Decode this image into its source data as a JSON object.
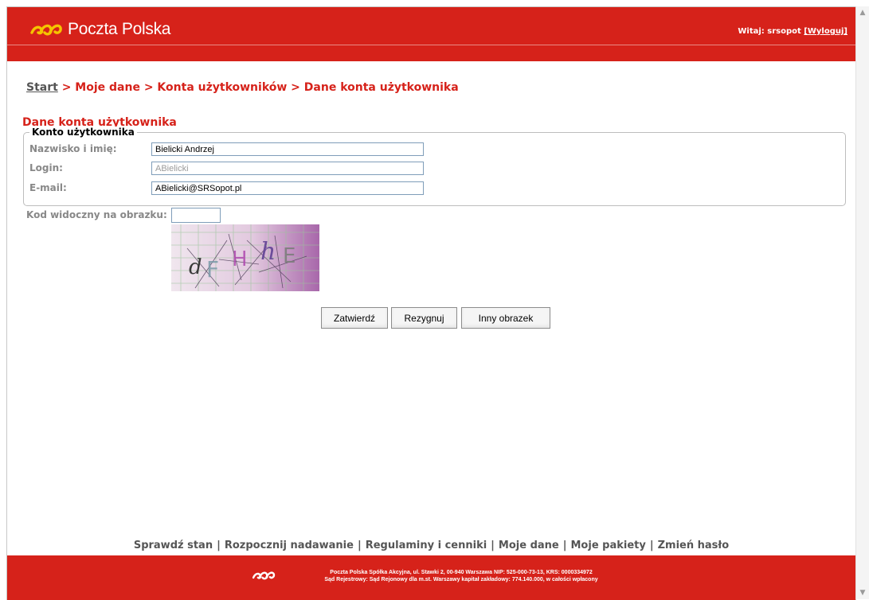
{
  "header": {
    "logo_text": "Poczta Polska",
    "welcome_prefix": "Witaj: srsopot",
    "logout_label": "[Wyloguj]"
  },
  "breadcrumb": {
    "start": "Start",
    "rest": " > Moje dane > Konta użytkowników > Dane konta użytkownika"
  },
  "page_title": "Dane konta użytkownika",
  "account": {
    "legend": "Konto użytkownika",
    "fields": [
      {
        "label": "Nazwisko i imię:",
        "value": "Bielicki Andrzej",
        "enabled": true
      },
      {
        "label": "Login:",
        "value": "ABielicki",
        "enabled": false
      },
      {
        "label": "E-mail:",
        "value": "ABielicki@SRSopot.pl",
        "enabled": true
      }
    ]
  },
  "captcha": {
    "label": "Kod widoczny na obrazku:",
    "value": "",
    "chars": [
      "d",
      "F",
      "H",
      "h",
      "E"
    ]
  },
  "buttons": {
    "confirm": "Zatwierdź",
    "cancel": "Rezygnuj",
    "other_image": "Inny obrazek"
  },
  "footer_nav": [
    "Sprawdź stan",
    "Rozpocznij nadawanie",
    "Regulaminy i cenniki",
    "Moje dane",
    "Moje pakiety",
    "Zmień hasło"
  ],
  "footer": {
    "line1": "Poczta Polska Spółka Akcyjna, ul. Stawki 2, 00-940 Warszawa NIP: 525-000-73-13, KRS: 0000334972",
    "line2": "Sąd Rejestrowy: Sąd Rejonowy dla m.st. Warszawy kapitał zakładowy: 774.140.000, w całości wpłacony"
  },
  "colors": {
    "brand_red": "#d6221a",
    "logo_yellow": "#f5c400"
  },
  "icons": [
    "horn-logo-icon",
    "chevron-up-icon",
    "chevron-down-icon"
  ]
}
